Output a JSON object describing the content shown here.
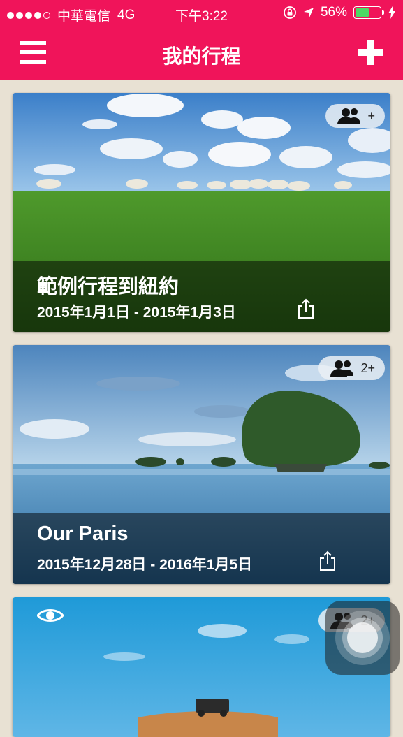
{
  "status_bar": {
    "carrier": "中華電信",
    "network": "4G",
    "time": "下午3:22",
    "battery_percent_text": "56%",
    "battery_level": 0.56,
    "battery_color": "#4cd964"
  },
  "nav": {
    "title": "我的行程",
    "menu_icon": "hamburger-icon",
    "add_icon": "plus-icon",
    "background_color": "#f0145a"
  },
  "trips": [
    {
      "title": "範例行程到紐約",
      "dates": "2015年1月1日 - 2015年1月3日",
      "members_badge": "+",
      "photo": "sheep on green meadow under blue sky"
    },
    {
      "title": "Our Paris",
      "dates": "2015年12月28日 - 2016年1月5日",
      "members_badge": "2+",
      "photo": "mushroom-shaped island in blue lagoon"
    },
    {
      "title": "",
      "dates": "",
      "members_badge": "2+",
      "photo": "blue sky over desert with vehicle",
      "visibility_icon": "eye-icon"
    }
  ]
}
